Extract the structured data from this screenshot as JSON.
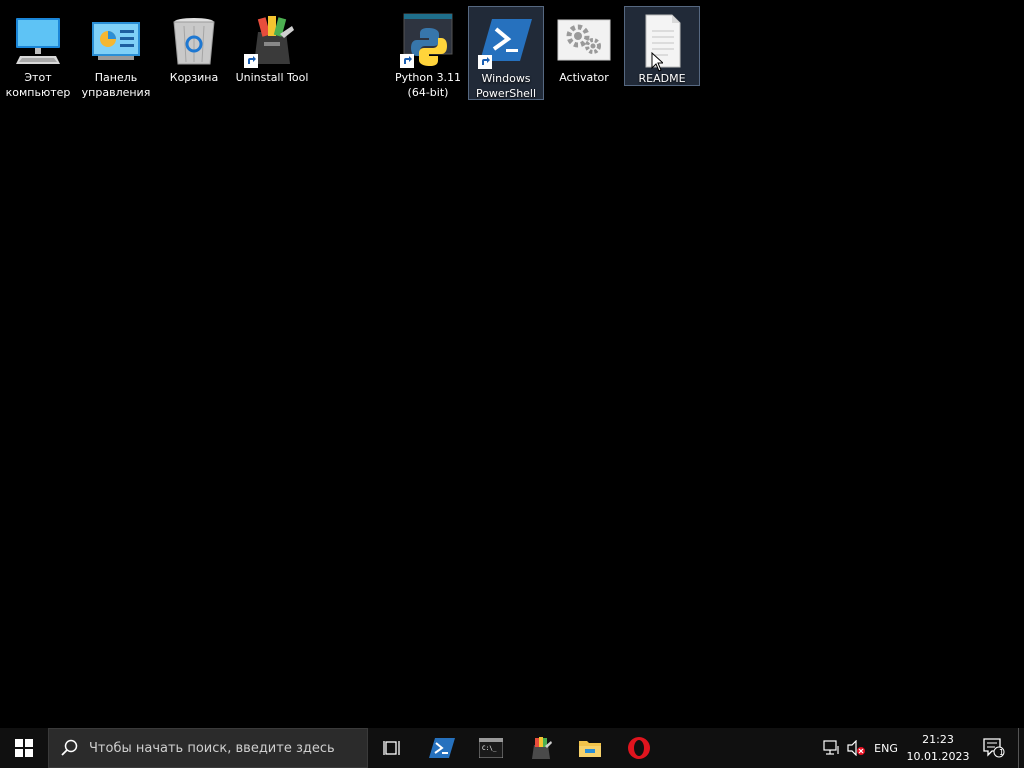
{
  "desktop": {
    "icons": [
      {
        "label": "Этот\nкомпьютер",
        "icon": "computer-icon"
      },
      {
        "label": "Панель\nуправления",
        "icon": "control-panel-icon"
      },
      {
        "label": "Корзина",
        "icon": "recycle-bin-icon"
      },
      {
        "label": "Uninstall Tool",
        "icon": "uninstall-tool-icon"
      },
      {
        "label": "Python 3.11\n(64-bit)",
        "icon": "python-icon"
      },
      {
        "label": "Windows\nPowerShell",
        "icon": "powershell-icon"
      },
      {
        "label": "Activator",
        "icon": "gears-icon"
      },
      {
        "label": "README",
        "icon": "text-file-icon"
      }
    ]
  },
  "taskbar": {
    "search_placeholder": "Чтобы начать поиск, введите здесь",
    "language": "ENG",
    "time": "21:23",
    "date": "10.01.2023",
    "notification_count": "1",
    "pinned": [
      {
        "icon": "task-view-icon"
      },
      {
        "icon": "powershell-icon"
      },
      {
        "icon": "command-prompt-icon"
      },
      {
        "icon": "uninstall-tool-icon"
      },
      {
        "icon": "file-explorer-icon"
      },
      {
        "icon": "opera-icon"
      }
    ]
  },
  "colors": {
    "desktop_bg": "#000000",
    "taskbar_bg": "#101010",
    "search_bg": "#2b2b2b",
    "selection": "#4a6a9a"
  }
}
